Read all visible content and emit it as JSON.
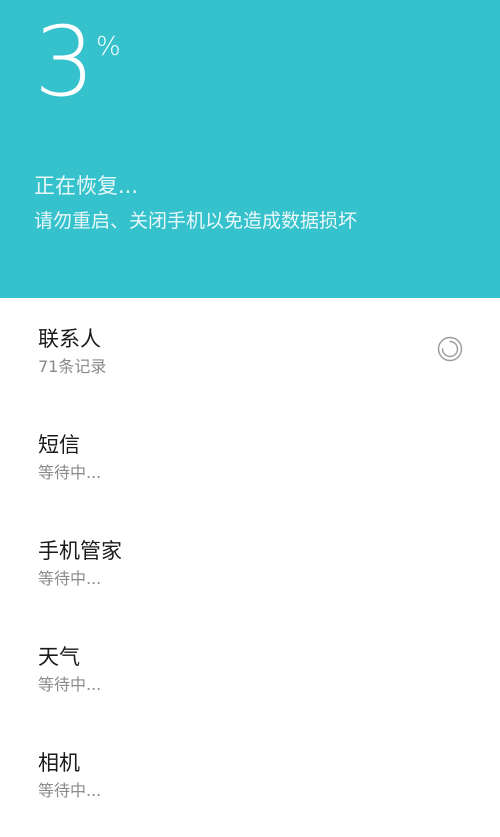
{
  "header": {
    "percent_value": "3",
    "percent_sign": "%",
    "status_title": "正在恢复...",
    "status_subtitle": "请勿重启、关闭手机以免造成数据损坏",
    "background_color": "#35c2cd"
  },
  "items": [
    {
      "title": "联系人",
      "subtitle": "71条记录",
      "state": "in-progress",
      "icon": "loading-spinner-icon"
    },
    {
      "title": "短信",
      "subtitle": "等待中..."
    },
    {
      "title": "手机管家",
      "subtitle": "等待中..."
    },
    {
      "title": "天气",
      "subtitle": "等待中..."
    },
    {
      "title": "相机",
      "subtitle": "等待中..."
    }
  ]
}
